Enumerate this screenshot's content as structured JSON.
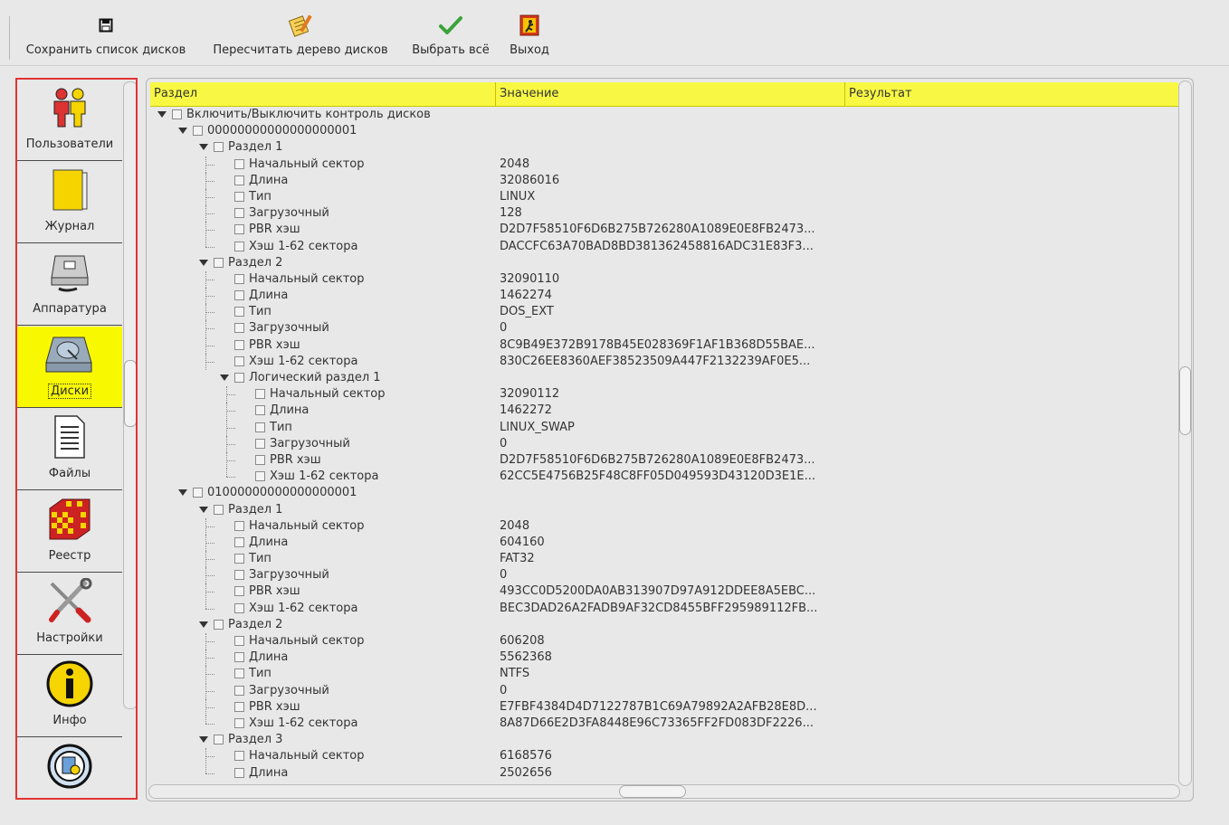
{
  "toolbar": {
    "save_label": "Сохранить список дисков",
    "rescan_label": "Пересчитать дерево дисков",
    "select_all_label": "Выбрать всё",
    "exit_label": "Выход"
  },
  "nav": [
    {
      "label": "Пользователи",
      "icon": "users-icon"
    },
    {
      "label": "Журнал",
      "icon": "journal-icon"
    },
    {
      "label": "Аппаратура",
      "icon": "hardware-icon"
    },
    {
      "label": "Диски",
      "icon": "disk-icon",
      "active": true
    },
    {
      "label": "Файлы",
      "icon": "file-icon"
    },
    {
      "label": "Реестр",
      "icon": "registry-icon"
    },
    {
      "label": "Настройки",
      "icon": "settings-icon"
    },
    {
      "label": "Инфо",
      "icon": "info-icon"
    },
    {
      "label": "",
      "icon": "update-icon"
    }
  ],
  "columns": {
    "section": "Раздел",
    "value": "Значение",
    "result": "Результат"
  },
  "tree": [
    {
      "name": "Включить/Выключить контроль дисков",
      "value": "",
      "level": 0,
      "expander": true
    },
    {
      "name": "00000000000000000001",
      "value": "",
      "level": 1,
      "expander": true
    },
    {
      "name": "Раздел 1",
      "value": "",
      "level": 2,
      "expander": true
    },
    {
      "name": "Начальный сектор",
      "value": "2048",
      "level": 3
    },
    {
      "name": "Длина",
      "value": "32086016",
      "level": 3
    },
    {
      "name": "Тип",
      "value": "LINUX",
      "level": 3
    },
    {
      "name": "Загрузочный",
      "value": "128",
      "level": 3
    },
    {
      "name": "PBR хэш",
      "value": "D2D7F58510F6D6B275B726280A1089E0E8FB2473...",
      "level": 3
    },
    {
      "name": "Хэш 1-62 сектора",
      "value": "DACCFC63A70BAD8BD381362458816ADC31E83F3...",
      "level": 3,
      "last": true
    },
    {
      "name": "Раздел 2",
      "value": "",
      "level": 2,
      "expander": true
    },
    {
      "name": "Начальный сектор",
      "value": "32090110",
      "level": 3
    },
    {
      "name": "Длина",
      "value": "1462274",
      "level": 3
    },
    {
      "name": "Тип",
      "value": "DOS_EXT",
      "level": 3
    },
    {
      "name": "Загрузочный",
      "value": "0",
      "level": 3
    },
    {
      "name": "PBR хэш",
      "value": "8C9B49E372B9178B45E028369F1AF1B368D55BAE...",
      "level": 3
    },
    {
      "name": "Хэш 1-62 сектора",
      "value": "830C26EE8360AEF38523509A447F2132239AF0E5...",
      "level": 3
    },
    {
      "name": "Логический раздел 1",
      "value": "",
      "level": 3,
      "expander": true,
      "last": true
    },
    {
      "name": "Начальный сектор",
      "value": "32090112",
      "level": 4
    },
    {
      "name": "Длина",
      "value": "1462272",
      "level": 4
    },
    {
      "name": "Тип",
      "value": "LINUX_SWAP",
      "level": 4
    },
    {
      "name": "Загрузочный",
      "value": "0",
      "level": 4
    },
    {
      "name": "PBR хэш",
      "value": "D2D7F58510F6D6B275B726280A1089E0E8FB2473...",
      "level": 4
    },
    {
      "name": "Хэш 1-62 сектора",
      "value": "62CC5E4756B25F48C8FF05D049593D43120D3E1E...",
      "level": 4,
      "last": true
    },
    {
      "name": "01000000000000000001",
      "value": "",
      "level": 1,
      "expander": true
    },
    {
      "name": "Раздел 1",
      "value": "",
      "level": 2,
      "expander": true
    },
    {
      "name": "Начальный сектор",
      "value": "2048",
      "level": 3
    },
    {
      "name": "Длина",
      "value": "604160",
      "level": 3
    },
    {
      "name": "Тип",
      "value": "FAT32",
      "level": 3
    },
    {
      "name": "Загрузочный",
      "value": "0",
      "level": 3
    },
    {
      "name": "PBR хэш",
      "value": "493CC0D5200DA0AB313907D97A912DDEE8A5EBC...",
      "level": 3
    },
    {
      "name": "Хэш 1-62 сектора",
      "value": "BEC3DAD26A2FADB9AF32CD8455BFF295989112FB...",
      "level": 3,
      "last": true
    },
    {
      "name": "Раздел 2",
      "value": "",
      "level": 2,
      "expander": true
    },
    {
      "name": "Начальный сектор",
      "value": "606208",
      "level": 3
    },
    {
      "name": "Длина",
      "value": "5562368",
      "level": 3
    },
    {
      "name": "Тип",
      "value": "NTFS",
      "level": 3
    },
    {
      "name": "Загрузочный",
      "value": "0",
      "level": 3
    },
    {
      "name": "PBR хэш",
      "value": "E7FBF4384D4D7122787B1C69A79892A2AFB28E8D...",
      "level": 3
    },
    {
      "name": "Хэш 1-62 сектора",
      "value": "8A87D66E2D3FA8448E96C73365FF2FD083DF2226...",
      "level": 3,
      "last": true
    },
    {
      "name": "Раздел 3",
      "value": "",
      "level": 2,
      "expander": true
    },
    {
      "name": "Начальный сектор",
      "value": "6168576",
      "level": 3
    },
    {
      "name": "Длина",
      "value": "2502656",
      "level": 3
    }
  ],
  "colors": {
    "accent": "#f8f800",
    "header_bg": "#f8f844",
    "nav_border": "#e23333"
  }
}
